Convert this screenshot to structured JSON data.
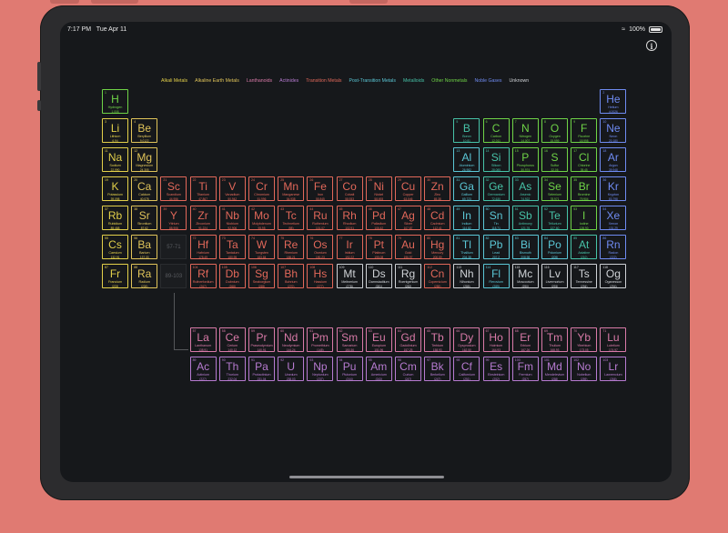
{
  "status": {
    "time": "7:17 PM",
    "date": "Tue Apr 11",
    "battery": "100%",
    "battery_fraction": 1.0
  },
  "colors": {
    "alkali": "#e3d04a",
    "alkaline": "#e0c45a",
    "lanthanoid": "#d97aa8",
    "actinide": "#b77bd1",
    "transition": "#e2685a",
    "post": "#5bc7d6",
    "metalloid": "#47c3a8",
    "nonmetal": "#6fd447",
    "noble": "#6f8bf2",
    "unknown": "#cfd2d6"
  },
  "legend": [
    {
      "label": "Alkali Metals",
      "color": "#e3d04a"
    },
    {
      "label": "Alkaline Earth Metals",
      "color": "#e0c45a"
    },
    {
      "label": "Lanthanoids",
      "color": "#d97aa8"
    },
    {
      "label": "Actinides",
      "color": "#b77bd1"
    },
    {
      "label": "Transition Metals",
      "color": "#e2685a"
    },
    {
      "label": "Post-Transition Metals",
      "color": "#5bc7d6"
    },
    {
      "label": "Metalloids",
      "color": "#47c3a8"
    },
    {
      "label": "Other Nonmetals",
      "color": "#6fd447"
    },
    {
      "label": "Noble Gases",
      "color": "#6f8bf2"
    },
    {
      "label": "Unknown",
      "color": "#cfd2d6"
    }
  ],
  "placeholders": [
    "57-71",
    "89-103"
  ],
  "elements": [
    {
      "n": 1,
      "s": "H",
      "name": "Hydrogen",
      "m": "1.008",
      "c": "nonmetal",
      "g": 1,
      "p": 1
    },
    {
      "n": 2,
      "s": "He",
      "name": "Helium",
      "m": "4.0026",
      "c": "noble",
      "g": 18,
      "p": 1
    },
    {
      "n": 3,
      "s": "Li",
      "name": "Lithium",
      "m": "6.94",
      "c": "alkali",
      "g": 1,
      "p": 2
    },
    {
      "n": 4,
      "s": "Be",
      "name": "Beryllium",
      "m": "9.0122",
      "c": "alkaline",
      "g": 2,
      "p": 2
    },
    {
      "n": 5,
      "s": "B",
      "name": "Boron",
      "m": "10.81",
      "c": "metalloid",
      "g": 13,
      "p": 2
    },
    {
      "n": 6,
      "s": "C",
      "name": "Carbon",
      "m": "12.011",
      "c": "nonmetal",
      "g": 14,
      "p": 2
    },
    {
      "n": 7,
      "s": "N",
      "name": "Nitrogen",
      "m": "14.007",
      "c": "nonmetal",
      "g": 15,
      "p": 2
    },
    {
      "n": 8,
      "s": "O",
      "name": "Oxygen",
      "m": "15.999",
      "c": "nonmetal",
      "g": 16,
      "p": 2
    },
    {
      "n": 9,
      "s": "F",
      "name": "Fluorine",
      "m": "18.998",
      "c": "nonmetal",
      "g": 17,
      "p": 2
    },
    {
      "n": 10,
      "s": "Ne",
      "name": "Neon",
      "m": "20.180",
      "c": "noble",
      "g": 18,
      "p": 2
    },
    {
      "n": 11,
      "s": "Na",
      "name": "Sodium",
      "m": "22.990",
      "c": "alkali",
      "g": 1,
      "p": 3
    },
    {
      "n": 12,
      "s": "Mg",
      "name": "Magnesium",
      "m": "24.305",
      "c": "alkaline",
      "g": 2,
      "p": 3
    },
    {
      "n": 13,
      "s": "Al",
      "name": "Aluminium",
      "m": "26.982",
      "c": "post",
      "g": 13,
      "p": 3
    },
    {
      "n": 14,
      "s": "Si",
      "name": "Silicon",
      "m": "28.085",
      "c": "metalloid",
      "g": 14,
      "p": 3
    },
    {
      "n": 15,
      "s": "P",
      "name": "Phosphorus",
      "m": "30.974",
      "c": "nonmetal",
      "g": 15,
      "p": 3
    },
    {
      "n": 16,
      "s": "S",
      "name": "Sulfur",
      "m": "32.06",
      "c": "nonmetal",
      "g": 16,
      "p": 3
    },
    {
      "n": 17,
      "s": "Cl",
      "name": "Chlorine",
      "m": "35.45",
      "c": "nonmetal",
      "g": 17,
      "p": 3
    },
    {
      "n": 18,
      "s": "Ar",
      "name": "Argon",
      "m": "39.948",
      "c": "noble",
      "g": 18,
      "p": 3
    },
    {
      "n": 19,
      "s": "K",
      "name": "Potassium",
      "m": "39.098",
      "c": "alkali",
      "g": 1,
      "p": 4
    },
    {
      "n": 20,
      "s": "Ca",
      "name": "Calcium",
      "m": "40.078",
      "c": "alkaline",
      "g": 2,
      "p": 4
    },
    {
      "n": 21,
      "s": "Sc",
      "name": "Scandium",
      "m": "44.956",
      "c": "transition",
      "g": 3,
      "p": 4
    },
    {
      "n": 22,
      "s": "Ti",
      "name": "Titanium",
      "m": "47.867",
      "c": "transition",
      "g": 4,
      "p": 4
    },
    {
      "n": 23,
      "s": "V",
      "name": "Vanadium",
      "m": "50.942",
      "c": "transition",
      "g": 5,
      "p": 4
    },
    {
      "n": 24,
      "s": "Cr",
      "name": "Chromium",
      "m": "51.996",
      "c": "transition",
      "g": 6,
      "p": 4
    },
    {
      "n": 25,
      "s": "Mn",
      "name": "Manganese",
      "m": "54.938",
      "c": "transition",
      "g": 7,
      "p": 4
    },
    {
      "n": 26,
      "s": "Fe",
      "name": "Iron",
      "m": "55.845",
      "c": "transition",
      "g": 8,
      "p": 4
    },
    {
      "n": 27,
      "s": "Co",
      "name": "Cobalt",
      "m": "58.933",
      "c": "transition",
      "g": 9,
      "p": 4
    },
    {
      "n": 28,
      "s": "Ni",
      "name": "Nickel",
      "m": "58.693",
      "c": "transition",
      "g": 10,
      "p": 4
    },
    {
      "n": 29,
      "s": "Cu",
      "name": "Copper",
      "m": "63.546",
      "c": "transition",
      "g": 11,
      "p": 4
    },
    {
      "n": 30,
      "s": "Zn",
      "name": "Zinc",
      "m": "65.38",
      "c": "transition",
      "g": 12,
      "p": 4
    },
    {
      "n": 31,
      "s": "Ga",
      "name": "Gallium",
      "m": "69.723",
      "c": "post",
      "g": 13,
      "p": 4
    },
    {
      "n": 32,
      "s": "Ge",
      "name": "Germanium",
      "m": "72.630",
      "c": "metalloid",
      "g": 14,
      "p": 4
    },
    {
      "n": 33,
      "s": "As",
      "name": "Arsenic",
      "m": "74.922",
      "c": "metalloid",
      "g": 15,
      "p": 4
    },
    {
      "n": 34,
      "s": "Se",
      "name": "Selenium",
      "m": "78.971",
      "c": "nonmetal",
      "g": 16,
      "p": 4
    },
    {
      "n": 35,
      "s": "Br",
      "name": "Bromine",
      "m": "79.904",
      "c": "nonmetal",
      "g": 17,
      "p": 4
    },
    {
      "n": 36,
      "s": "Kr",
      "name": "Krypton",
      "m": "83.798",
      "c": "noble",
      "g": 18,
      "p": 4
    },
    {
      "n": 37,
      "s": "Rb",
      "name": "Rubidium",
      "m": "85.468",
      "c": "alkali",
      "g": 1,
      "p": 5
    },
    {
      "n": 38,
      "s": "Sr",
      "name": "Strontium",
      "m": "87.62",
      "c": "alkaline",
      "g": 2,
      "p": 5
    },
    {
      "n": 39,
      "s": "Y",
      "name": "Yttrium",
      "m": "88.906",
      "c": "transition",
      "g": 3,
      "p": 5
    },
    {
      "n": 40,
      "s": "Zr",
      "name": "Zirconium",
      "m": "91.224",
      "c": "transition",
      "g": 4,
      "p": 5
    },
    {
      "n": 41,
      "s": "Nb",
      "name": "Niobium",
      "m": "92.906",
      "c": "transition",
      "g": 5,
      "p": 5
    },
    {
      "n": 42,
      "s": "Mo",
      "name": "Molybdenum",
      "m": "95.95",
      "c": "transition",
      "g": 6,
      "p": 5
    },
    {
      "n": 43,
      "s": "Tc",
      "name": "Technetium",
      "m": "(98)",
      "c": "transition",
      "g": 7,
      "p": 5
    },
    {
      "n": 44,
      "s": "Ru",
      "name": "Ruthenium",
      "m": "101.07",
      "c": "transition",
      "g": 8,
      "p": 5
    },
    {
      "n": 45,
      "s": "Rh",
      "name": "Rhodium",
      "m": "102.91",
      "c": "transition",
      "g": 9,
      "p": 5
    },
    {
      "n": 46,
      "s": "Pd",
      "name": "Palladium",
      "m": "106.42",
      "c": "transition",
      "g": 10,
      "p": 5
    },
    {
      "n": 47,
      "s": "Ag",
      "name": "Silver",
      "m": "107.87",
      "c": "transition",
      "g": 11,
      "p": 5
    },
    {
      "n": 48,
      "s": "Cd",
      "name": "Cadmium",
      "m": "112.41",
      "c": "transition",
      "g": 12,
      "p": 5
    },
    {
      "n": 49,
      "s": "In",
      "name": "Indium",
      "m": "114.82",
      "c": "post",
      "g": 13,
      "p": 5
    },
    {
      "n": 50,
      "s": "Sn",
      "name": "Tin",
      "m": "118.71",
      "c": "post",
      "g": 14,
      "p": 5
    },
    {
      "n": 51,
      "s": "Sb",
      "name": "Antimony",
      "m": "121.76",
      "c": "metalloid",
      "g": 15,
      "p": 5
    },
    {
      "n": 52,
      "s": "Te",
      "name": "Tellurium",
      "m": "127.60",
      "c": "metalloid",
      "g": 16,
      "p": 5
    },
    {
      "n": 53,
      "s": "I",
      "name": "Iodine",
      "m": "126.90",
      "c": "nonmetal",
      "g": 17,
      "p": 5
    },
    {
      "n": 54,
      "s": "Xe",
      "name": "Xenon",
      "m": "131.29",
      "c": "noble",
      "g": 18,
      "p": 5
    },
    {
      "n": 55,
      "s": "Cs",
      "name": "Caesium",
      "m": "132.91",
      "c": "alkali",
      "g": 1,
      "p": 6
    },
    {
      "n": 56,
      "s": "Ba",
      "name": "Barium",
      "m": "137.33",
      "c": "alkaline",
      "g": 2,
      "p": 6
    },
    {
      "n": 72,
      "s": "Hf",
      "name": "Hafnium",
      "m": "178.49",
      "c": "transition",
      "g": 4,
      "p": 6
    },
    {
      "n": 73,
      "s": "Ta",
      "name": "Tantalum",
      "m": "180.95",
      "c": "transition",
      "g": 5,
      "p": 6
    },
    {
      "n": 74,
      "s": "W",
      "name": "Tungsten",
      "m": "183.84",
      "c": "transition",
      "g": 6,
      "p": 6
    },
    {
      "n": 75,
      "s": "Re",
      "name": "Rhenium",
      "m": "186.21",
      "c": "transition",
      "g": 7,
      "p": 6
    },
    {
      "n": 76,
      "s": "Os",
      "name": "Osmium",
      "m": "190.23",
      "c": "transition",
      "g": 8,
      "p": 6
    },
    {
      "n": 77,
      "s": "Ir",
      "name": "Iridium",
      "m": "192.22",
      "c": "transition",
      "g": 9,
      "p": 6
    },
    {
      "n": 78,
      "s": "Pt",
      "name": "Platinum",
      "m": "195.08",
      "c": "transition",
      "g": 10,
      "p": 6
    },
    {
      "n": 79,
      "s": "Au",
      "name": "Gold",
      "m": "196.97",
      "c": "transition",
      "g": 11,
      "p": 6
    },
    {
      "n": 80,
      "s": "Hg",
      "name": "Mercury",
      "m": "200.59",
      "c": "transition",
      "g": 12,
      "p": 6
    },
    {
      "n": 81,
      "s": "Tl",
      "name": "Thallium",
      "m": "204.38",
      "c": "post",
      "g": 13,
      "p": 6
    },
    {
      "n": 82,
      "s": "Pb",
      "name": "Lead",
      "m": "207.2",
      "c": "post",
      "g": 14,
      "p": 6
    },
    {
      "n": 83,
      "s": "Bi",
      "name": "Bismuth",
      "m": "208.98",
      "c": "post",
      "g": 15,
      "p": 6
    },
    {
      "n": 84,
      "s": "Po",
      "name": "Polonium",
      "m": "(209)",
      "c": "post",
      "g": 16,
      "p": 6
    },
    {
      "n": 85,
      "s": "At",
      "name": "Astatine",
      "m": "(210)",
      "c": "metalloid",
      "g": 17,
      "p": 6
    },
    {
      "n": 86,
      "s": "Rn",
      "name": "Radon",
      "m": "(222)",
      "c": "noble",
      "g": 18,
      "p": 6
    },
    {
      "n": 87,
      "s": "Fr",
      "name": "Francium",
      "m": "(223)",
      "c": "alkali",
      "g": 1,
      "p": 7
    },
    {
      "n": 88,
      "s": "Ra",
      "name": "Radium",
      "m": "(226)",
      "c": "alkaline",
      "g": 2,
      "p": 7
    },
    {
      "n": 104,
      "s": "Rf",
      "name": "Rutherfordium",
      "m": "(267)",
      "c": "transition",
      "g": 4,
      "p": 7
    },
    {
      "n": 105,
      "s": "Db",
      "name": "Dubnium",
      "m": "(268)",
      "c": "transition",
      "g": 5,
      "p": 7
    },
    {
      "n": 106,
      "s": "Sg",
      "name": "Seaborgium",
      "m": "(269)",
      "c": "transition",
      "g": 6,
      "p": 7
    },
    {
      "n": 107,
      "s": "Bh",
      "name": "Bohrium",
      "m": "(270)",
      "c": "transition",
      "g": 7,
      "p": 7
    },
    {
      "n": 108,
      "s": "Hs",
      "name": "Hassium",
      "m": "(277)",
      "c": "transition",
      "g": 8,
      "p": 7
    },
    {
      "n": 109,
      "s": "Mt",
      "name": "Meitnerium",
      "m": "(278)",
      "c": "unknown",
      "g": 9,
      "p": 7
    },
    {
      "n": 110,
      "s": "Ds",
      "name": "Darmstadtium",
      "m": "(281)",
      "c": "unknown",
      "g": 10,
      "p": 7
    },
    {
      "n": 111,
      "s": "Rg",
      "name": "Roentgenium",
      "m": "(282)",
      "c": "unknown",
      "g": 11,
      "p": 7
    },
    {
      "n": 112,
      "s": "Cn",
      "name": "Copernicium",
      "m": "(285)",
      "c": "transition",
      "g": 12,
      "p": 7
    },
    {
      "n": 113,
      "s": "Nh",
      "name": "Nihonium",
      "m": "(286)",
      "c": "unknown",
      "g": 13,
      "p": 7
    },
    {
      "n": 114,
      "s": "Fl",
      "name": "Flerovium",
      "m": "(289)",
      "c": "post",
      "g": 14,
      "p": 7
    },
    {
      "n": 115,
      "s": "Mc",
      "name": "Moscovium",
      "m": "(290)",
      "c": "unknown",
      "g": 15,
      "p": 7
    },
    {
      "n": 116,
      "s": "Lv",
      "name": "Livermorium",
      "m": "(293)",
      "c": "unknown",
      "g": 16,
      "p": 7
    },
    {
      "n": 117,
      "s": "Ts",
      "name": "Tennessine",
      "m": "(294)",
      "c": "unknown",
      "g": 17,
      "p": 7
    },
    {
      "n": 118,
      "s": "Og",
      "name": "Oganesson",
      "m": "(294)",
      "c": "unknown",
      "g": 18,
      "p": 7
    },
    {
      "n": 57,
      "s": "La",
      "name": "Lanthanum",
      "m": "138.91",
      "c": "lanthanoid",
      "g": 4,
      "p": 9
    },
    {
      "n": 58,
      "s": "Ce",
      "name": "Cerium",
      "m": "140.12",
      "c": "lanthanoid",
      "g": 5,
      "p": 9
    },
    {
      "n": 59,
      "s": "Pr",
      "name": "Praseodymium",
      "m": "140.91",
      "c": "lanthanoid",
      "g": 6,
      "p": 9
    },
    {
      "n": 60,
      "s": "Nd",
      "name": "Neodymium",
      "m": "144.24",
      "c": "lanthanoid",
      "g": 7,
      "p": 9
    },
    {
      "n": 61,
      "s": "Pm",
      "name": "Promethium",
      "m": "(145)",
      "c": "lanthanoid",
      "g": 8,
      "p": 9
    },
    {
      "n": 62,
      "s": "Sm",
      "name": "Samarium",
      "m": "150.36",
      "c": "lanthanoid",
      "g": 9,
      "p": 9
    },
    {
      "n": 63,
      "s": "Eu",
      "name": "Europium",
      "m": "151.96",
      "c": "lanthanoid",
      "g": 10,
      "p": 9
    },
    {
      "n": 64,
      "s": "Gd",
      "name": "Gadolinium",
      "m": "157.25",
      "c": "lanthanoid",
      "g": 11,
      "p": 9
    },
    {
      "n": 65,
      "s": "Tb",
      "name": "Terbium",
      "m": "158.93",
      "c": "lanthanoid",
      "g": 12,
      "p": 9
    },
    {
      "n": 66,
      "s": "Dy",
      "name": "Dysprosium",
      "m": "162.50",
      "c": "lanthanoid",
      "g": 13,
      "p": 9
    },
    {
      "n": 67,
      "s": "Ho",
      "name": "Holmium",
      "m": "164.93",
      "c": "lanthanoid",
      "g": 14,
      "p": 9
    },
    {
      "n": 68,
      "s": "Er",
      "name": "Erbium",
      "m": "167.26",
      "c": "lanthanoid",
      "g": 15,
      "p": 9
    },
    {
      "n": 69,
      "s": "Tm",
      "name": "Thulium",
      "m": "168.93",
      "c": "lanthanoid",
      "g": 16,
      "p": 9
    },
    {
      "n": 70,
      "s": "Yb",
      "name": "Ytterbium",
      "m": "173.05",
      "c": "lanthanoid",
      "g": 17,
      "p": 9
    },
    {
      "n": 71,
      "s": "Lu",
      "name": "Lutetium",
      "m": "174.97",
      "c": "lanthanoid",
      "g": 18,
      "p": 9
    },
    {
      "n": 89,
      "s": "Ac",
      "name": "Actinium",
      "m": "(227)",
      "c": "actinide",
      "g": 4,
      "p": 10
    },
    {
      "n": 90,
      "s": "Th",
      "name": "Thorium",
      "m": "232.04",
      "c": "actinide",
      "g": 5,
      "p": 10
    },
    {
      "n": 91,
      "s": "Pa",
      "name": "Protactinium",
      "m": "231.04",
      "c": "actinide",
      "g": 6,
      "p": 10
    },
    {
      "n": 92,
      "s": "U",
      "name": "Uranium",
      "m": "238.03",
      "c": "actinide",
      "g": 7,
      "p": 10
    },
    {
      "n": 93,
      "s": "Np",
      "name": "Neptunium",
      "m": "(237)",
      "c": "actinide",
      "g": 8,
      "p": 10
    },
    {
      "n": 94,
      "s": "Pu",
      "name": "Plutonium",
      "m": "(244)",
      "c": "actinide",
      "g": 9,
      "p": 10
    },
    {
      "n": 95,
      "s": "Am",
      "name": "Americium",
      "m": "(243)",
      "c": "actinide",
      "g": 10,
      "p": 10
    },
    {
      "n": 96,
      "s": "Cm",
      "name": "Curium",
      "m": "(247)",
      "c": "actinide",
      "g": 11,
      "p": 10
    },
    {
      "n": 97,
      "s": "Bk",
      "name": "Berkelium",
      "m": "(247)",
      "c": "actinide",
      "g": 12,
      "p": 10
    },
    {
      "n": 98,
      "s": "Cf",
      "name": "Californium",
      "m": "(251)",
      "c": "actinide",
      "g": 13,
      "p": 10
    },
    {
      "n": 99,
      "s": "Es",
      "name": "Einsteinium",
      "m": "(252)",
      "c": "actinide",
      "g": 14,
      "p": 10
    },
    {
      "n": 100,
      "s": "Fm",
      "name": "Fermium",
      "m": "(257)",
      "c": "actinide",
      "g": 15,
      "p": 10
    },
    {
      "n": 101,
      "s": "Md",
      "name": "Mendelevium",
      "m": "(258)",
      "c": "actinide",
      "g": 16,
      "p": 10
    },
    {
      "n": 102,
      "s": "No",
      "name": "Nobelium",
      "m": "(259)",
      "c": "actinide",
      "g": 17,
      "p": 10
    },
    {
      "n": 103,
      "s": "Lr",
      "name": "Lawrencium",
      "m": "(266)",
      "c": "actinide",
      "g": 18,
      "p": 10
    }
  ]
}
